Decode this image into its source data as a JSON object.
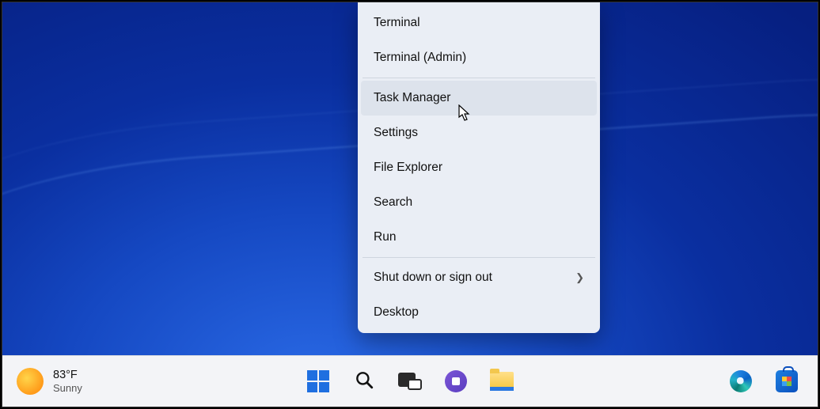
{
  "context_menu": {
    "items": [
      {
        "label": "Terminal",
        "submenu": false,
        "hover": false
      },
      {
        "label": "Terminal (Admin)",
        "submenu": false,
        "hover": false
      },
      {
        "label": "Task Manager",
        "submenu": false,
        "hover": true,
        "sep_before": true
      },
      {
        "label": "Settings",
        "submenu": false,
        "hover": false
      },
      {
        "label": "File Explorer",
        "submenu": false,
        "hover": false
      },
      {
        "label": "Search",
        "submenu": false,
        "hover": false
      },
      {
        "label": "Run",
        "submenu": false,
        "hover": false
      },
      {
        "label": "Shut down or sign out",
        "submenu": true,
        "hover": false,
        "sep_before": true
      },
      {
        "label": "Desktop",
        "submenu": false,
        "hover": false
      }
    ]
  },
  "weather": {
    "temp": "83°F",
    "condition": "Sunny"
  },
  "taskbar_icons": {
    "start": "start-button",
    "search": "search-button",
    "taskview": "task-view-button",
    "chat": "chat-button",
    "explorer": "file-explorer-button",
    "edge": "edge-button",
    "store": "microsoft-store-button"
  }
}
